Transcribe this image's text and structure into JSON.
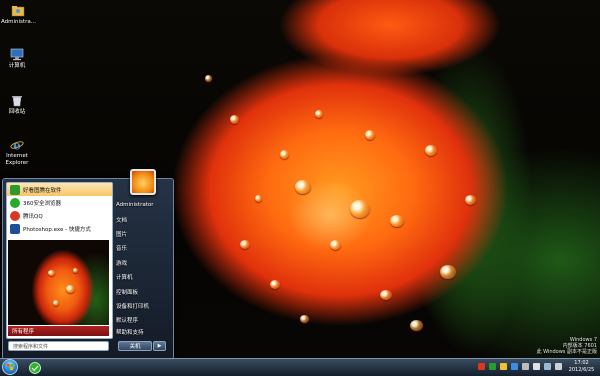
{
  "desktop": {
    "icons": [
      {
        "label": "Administra...",
        "icon": "user-folder-icon"
      },
      {
        "label": "计算机",
        "icon": "computer-icon"
      },
      {
        "label": "回收站",
        "icon": "recycle-bin-icon"
      },
      {
        "label": "Internet Explorer",
        "label_lines": [
          "Internet",
          "Explorer"
        ],
        "icon": "internet-explorer-icon"
      }
    ]
  },
  "start_menu": {
    "pinned": [
      {
        "label": "好看图腾在软件",
        "icon": "green-app-icon",
        "color": "#2e9a2e"
      },
      {
        "label": "360安全浏览器",
        "icon": "360-browser-icon",
        "color": "#29a829"
      },
      {
        "label": "腾讯QQ",
        "icon": "qq-icon",
        "color": "#d9381e"
      },
      {
        "label": "Photoshop.exe - 快捷方式",
        "icon": "photoshop-icon",
        "color": "#1b4f96"
      }
    ],
    "all_programs": "所有程序",
    "search_placeholder": "搜索程序和文件",
    "right_items": [
      "Administrator",
      "文档",
      "图片",
      "音乐",
      "游戏",
      "计算机",
      "控制面板",
      "设备和打印机",
      "默认程序",
      "帮助和支持"
    ],
    "shutdown_label": "关机",
    "shutdown_arrow": "▶"
  },
  "watermark": {
    "lines": [
      "Windows 7",
      "内部版本 7601",
      "此 Windows 副本不是正版"
    ]
  },
  "taskbar": {
    "clock_time": "17:02",
    "clock_date": "2012/6/25"
  },
  "colors": {
    "accent": "#2f7fc4",
    "highlight": "#f6c56a",
    "all_programs_bar": "#b02222"
  }
}
